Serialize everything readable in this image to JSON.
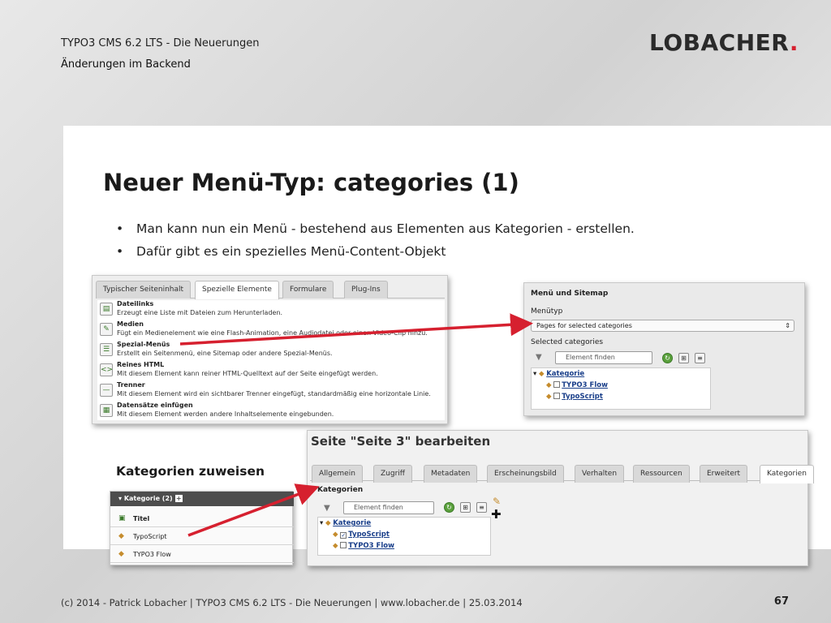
{
  "header": {
    "line1": "TYPO3 CMS 6.2 LTS - Die Neuerungen",
    "line2": "Änderungen im Backend",
    "logo_text": "LOBACHER",
    "logo_dot": "."
  },
  "slide": {
    "title": "Neuer Menü-Typ: categories (1)",
    "bullets": [
      "Man kann nun ein Menü - bestehend aus Elementen aus Kategorien - erstellen.",
      "Dafür gibt es ein spezielles Menü-Content-Objekt"
    ],
    "assign_label": "Kategorien zuweisen"
  },
  "wizard": {
    "tabs": [
      "Typischer Seiteninhalt",
      "Spezielle Elemente",
      "Formulare",
      "Plug-Ins"
    ],
    "active_tab": "Spezielle Elemente",
    "items": [
      {
        "title": "Dateilinks",
        "desc": "Erzeugt eine Liste mit Dateien zum Herunterladen.",
        "icon": "file-links-icon"
      },
      {
        "title": "Medien",
        "desc": "Fügt ein Medienelement wie eine Flash-Animation, eine Audiodatei oder einen Video-Clip hinzu.",
        "icon": "media-icon"
      },
      {
        "title": "Spezial-Menüs",
        "desc": "Erstellt ein Seitenmenü, eine Sitemap oder andere Spezial-Menüs.",
        "icon": "menu-icon"
      },
      {
        "title": "Reines HTML",
        "desc": "Mit diesem Element kann reiner HTML-Quelltext auf der Seite eingefügt werden.",
        "icon": "html-icon"
      },
      {
        "title": "Trenner",
        "desc": "Mit diesem Element wird ein sichtbarer Trenner eingefügt, standardmäßig eine horizontale Linie.",
        "icon": "divider-icon"
      },
      {
        "title": "Datensätze einfügen",
        "desc": "Mit diesem Element werden andere Inhaltselemente eingebunden.",
        "icon": "records-icon"
      }
    ]
  },
  "menu_panel": {
    "heading": "Menü und Sitemap",
    "menutype_label": "Menütyp",
    "menutype_value": "Pages for selected categories",
    "selected_label": "Selected categories",
    "filter_placeholder": "Element finden",
    "tree": {
      "root": "Kategorie",
      "children": [
        "TYPO3 Flow",
        "TypoScript"
      ]
    }
  },
  "page_edit": {
    "title": "Seite \"Seite 3\" bearbeiten",
    "tabs": [
      "Allgemein",
      "Zugriff",
      "Metadaten",
      "Erscheinungsbild",
      "Verhalten",
      "Ressourcen",
      "Erweitert",
      "Kategorien"
    ],
    "active_tab": "Kategorien",
    "section_label": "Kategorien",
    "filter_placeholder": "Element finden",
    "tree": {
      "root": "Kategorie",
      "children": [
        {
          "label": "TypoScript",
          "checked": true
        },
        {
          "label": "TYPO3 Flow",
          "checked": false
        }
      ]
    }
  },
  "category_box": {
    "header": "Kategorie (2)",
    "rows": [
      "Titel",
      "TypoScript",
      "TYPO3 Flow"
    ]
  },
  "footer": {
    "text": "(c) 2014 - Patrick Lobacher | TYPO3 CMS 6.2 LTS - Die Neuerungen | www.lobacher.de | 25.03.2014",
    "page": "67"
  },
  "colors": {
    "arrow": "#d6202f",
    "logo_dot": "#d6202f",
    "link": "#1a3f8a"
  }
}
